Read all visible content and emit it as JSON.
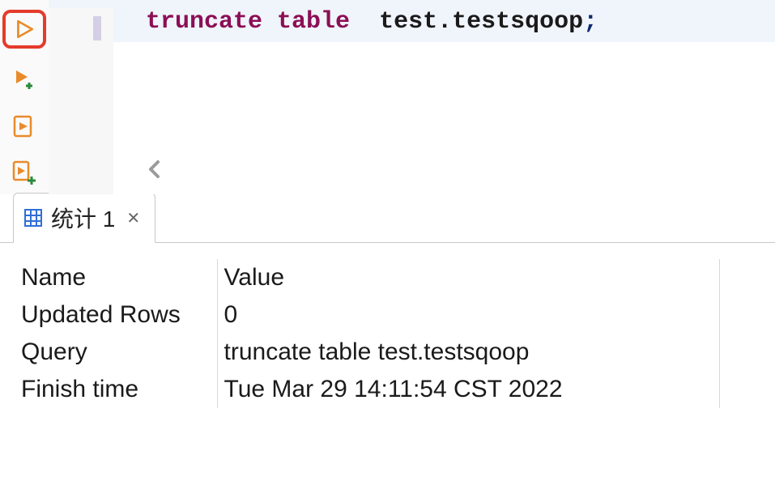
{
  "toolbar": {
    "execute": "execute",
    "executeNew": "execute-new",
    "executeScript": "execute-script",
    "executeScriptNew": "execute-script-new"
  },
  "editor": {
    "sql": {
      "kw1": "truncate",
      "kw2": "table",
      "target": "  test.testsqoop",
      "semi": ";"
    }
  },
  "tabs": {
    "stats": {
      "label": "统计 1"
    }
  },
  "results": {
    "headers": {
      "name": "Name",
      "value": "Value"
    },
    "rows": [
      {
        "name": "Updated Rows",
        "value": "0"
      },
      {
        "name": "Query",
        "value": "truncate table  test.testsqoop"
      },
      {
        "name": "Finish time",
        "value": "Tue Mar 29 14:11:54 CST 2022"
      }
    ]
  }
}
